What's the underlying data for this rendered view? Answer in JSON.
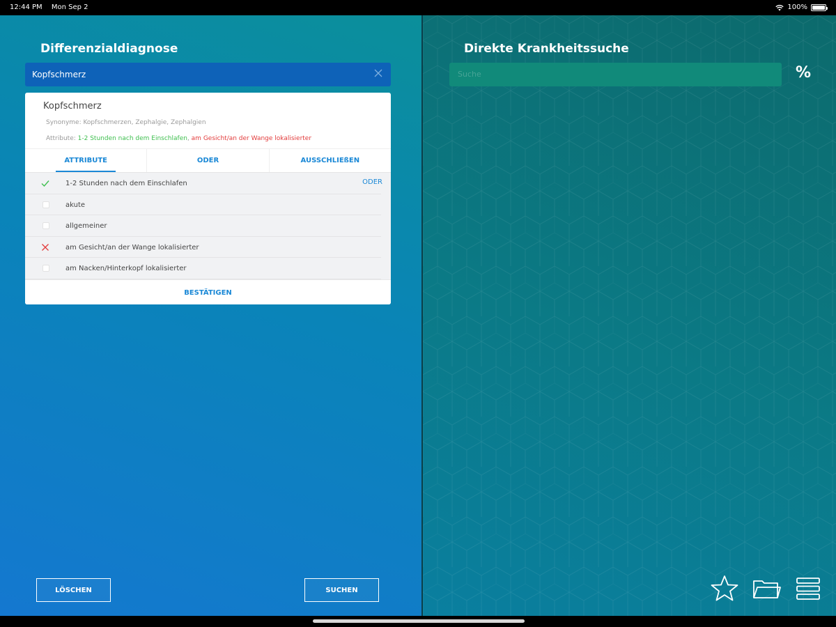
{
  "status": {
    "time": "12:44 PM",
    "date": "Mon Sep 2",
    "battery": "100%"
  },
  "left": {
    "title": "Differenzialdiagnose",
    "search_value": "Kopfschmerz",
    "card": {
      "term": "Kopfschmerz",
      "synonyms": "Synonyme: Kopfschmerzen, Zephalgie, Zephalgien",
      "attributes_prefix": "Attribute: ",
      "attribute_included": "1-2 Stunden nach dem Einschlafen",
      "attribute_separator": ", ",
      "attribute_excluded": "am Gesicht/an der Wange lokalisierter",
      "tabs": [
        {
          "label": "ATTRIBUTE"
        },
        {
          "label": "ODER"
        },
        {
          "label": "AUSSCHLIEßEN"
        }
      ],
      "items": [
        {
          "label": "1-2 Stunden nach dem Einschlafen",
          "state": "checked",
          "action": "ODER"
        },
        {
          "label": "akute",
          "state": "unchecked"
        },
        {
          "label": "allgemeiner",
          "state": "unchecked"
        },
        {
          "label": "am Gesicht/an der Wange lokalisierter",
          "state": "excluded"
        },
        {
          "label": "am Nacken/Hinterkopf lokalisierter",
          "state": "unchecked"
        }
      ],
      "confirm_label": "BESTÄTIGEN"
    },
    "clear_button": "LÖSCHEN",
    "search_button": "SUCHEN"
  },
  "right": {
    "title": "Direkte Krankheitssuche",
    "search_placeholder": "Suche",
    "percent_label": "%",
    "toolbar_icons": [
      "star-icon",
      "folder-icon",
      "menu-icon"
    ]
  },
  "colors": {
    "accent": "#1a88d6",
    "included": "#3fbf4f",
    "excluded": "#e23c3c"
  }
}
